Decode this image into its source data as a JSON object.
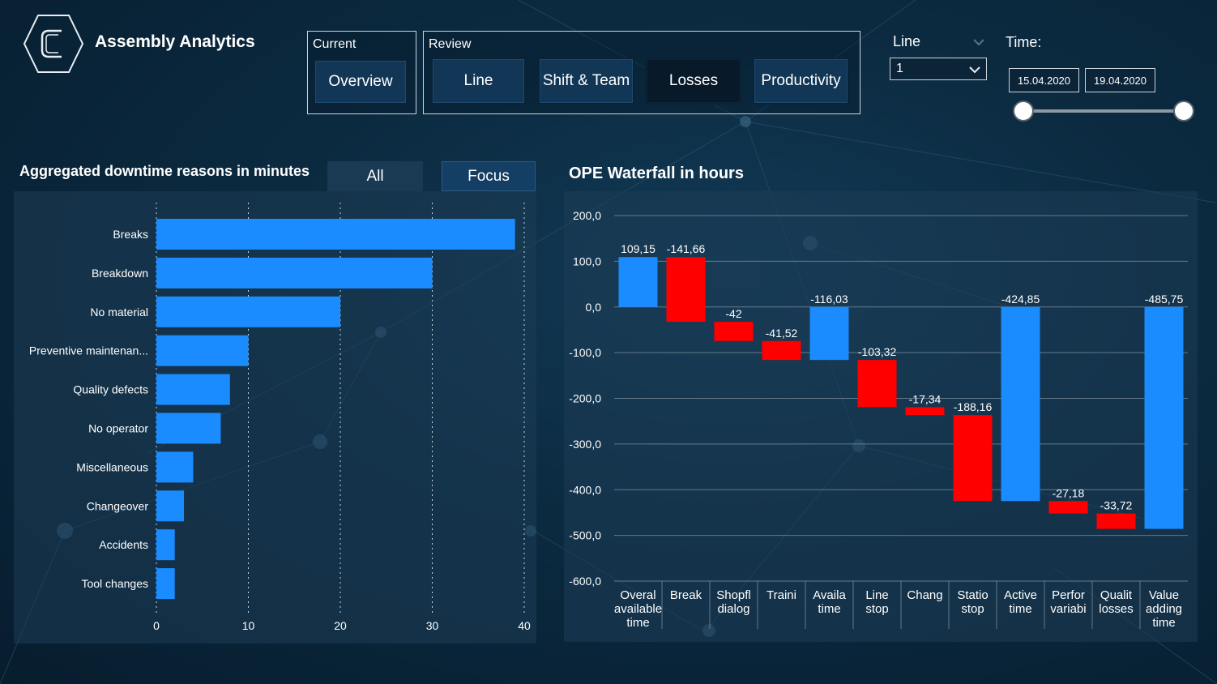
{
  "app": {
    "title": "Assembly Analytics"
  },
  "nav": {
    "current_label": "Current",
    "review_label": "Review",
    "overview": "Overview",
    "line": "Line",
    "shift_team": "Shift & Team",
    "losses": "Losses",
    "productivity": "Productivity",
    "active": "Losses"
  },
  "filters": {
    "line_label": "Line",
    "line_value": "1",
    "time_label": "Time:",
    "date_from": "15.04.2020",
    "date_to": "19.04.2020"
  },
  "downtime": {
    "title": "Aggregated downtime reasons in minutes",
    "toggle_all": "All",
    "toggle_focus": "Focus"
  },
  "waterfall": {
    "title": "OPE Waterfall in hours"
  },
  "colors": {
    "bar_blue": "#1a8cff",
    "bar_red": "#ff0000",
    "background": "#0b2a40",
    "panel": "#1e3c55"
  },
  "chart_data": [
    {
      "type": "bar",
      "orientation": "horizontal",
      "categories": [
        "Breaks",
        "Breakdown",
        "No material",
        "Preventive maintenan...",
        "Quality defects",
        "No operator",
        "Miscellaneous",
        "Changeover",
        "Accidents",
        "Tool changes"
      ],
      "values": [
        39,
        30,
        20,
        10,
        8,
        7,
        4,
        3,
        2,
        2
      ],
      "xlim": [
        0,
        40
      ],
      "xticks": [
        0,
        10,
        20,
        30,
        40
      ],
      "grid": "vertical dotted"
    },
    {
      "type": "bar",
      "subtype": "waterfall",
      "categories": [
        [
          "Overal",
          "available",
          "time"
        ],
        [
          "Break"
        ],
        [
          "Shopfl",
          "dialog"
        ],
        [
          "Traini"
        ],
        [
          "Availa",
          "time"
        ],
        [
          "Line",
          "stop"
        ],
        [
          "Chang"
        ],
        [
          "Statio",
          "stop"
        ],
        [
          "Active",
          "time"
        ],
        [
          "Perfor",
          "variabi"
        ],
        [
          "Qualit",
          "losses"
        ],
        [
          "Value",
          "adding",
          "time"
        ]
      ],
      "labels": [
        "109,15",
        "-141,66",
        "-42",
        "-41,52",
        "-116,03",
        "-103,32",
        "-17,34",
        "-188,16",
        "-424,85",
        "-27,18",
        "-33,72",
        "-485,75"
      ],
      "bars": [
        {
          "start": 0,
          "end": 109.15,
          "kind": "total"
        },
        {
          "start": 109.15,
          "end": -32.51,
          "kind": "decrease"
        },
        {
          "start": -32.51,
          "end": -74.51,
          "kind": "decrease"
        },
        {
          "start": -74.51,
          "end": -116.03,
          "kind": "decrease"
        },
        {
          "start": 0,
          "end": -116.03,
          "kind": "total"
        },
        {
          "start": -116.03,
          "end": -219.35,
          "kind": "decrease"
        },
        {
          "start": -219.35,
          "end": -236.69,
          "kind": "decrease"
        },
        {
          "start": -236.69,
          "end": -424.85,
          "kind": "decrease"
        },
        {
          "start": 0,
          "end": -424.85,
          "kind": "total"
        },
        {
          "start": -424.85,
          "end": -452.03,
          "kind": "decrease"
        },
        {
          "start": -452.03,
          "end": -485.75,
          "kind": "decrease"
        },
        {
          "start": 0,
          "end": -485.75,
          "kind": "total"
        }
      ],
      "ylim": [
        -600,
        200
      ],
      "yticks": [
        "200,0",
        "100,0",
        "0,0",
        "-100,0",
        "-200,0",
        "-300,0",
        "-400,0",
        "-500,0",
        "-600,0"
      ],
      "ytick_values": [
        200,
        100,
        0,
        -100,
        -200,
        -300,
        -400,
        -500,
        -600
      ],
      "grid": "horizontal"
    }
  ]
}
